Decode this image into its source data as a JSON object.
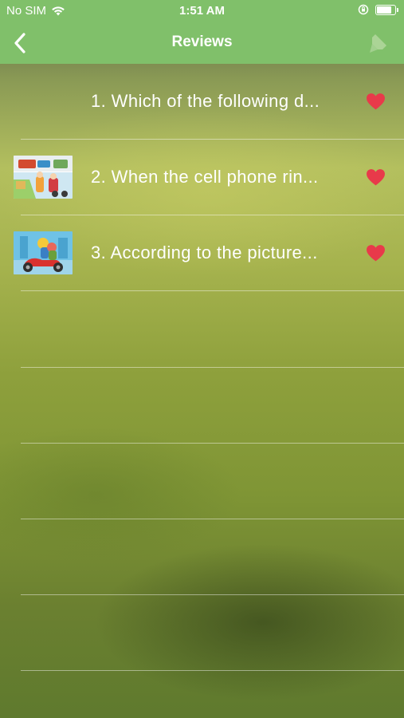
{
  "status_bar": {
    "carrier": "No SIM",
    "time": "1:51 AM",
    "battery_level": 0.9
  },
  "nav": {
    "title": "Reviews",
    "back_icon": "chevron-left-icon",
    "right_icon": "bookmark-icon"
  },
  "colors": {
    "bar": "#80c06a",
    "heart": "#e83a4a",
    "text": "#ffffff"
  },
  "reviews": [
    {
      "label": "1. Which of the following d...",
      "favorited": true,
      "has_image": false
    },
    {
      "label": "2. When the cell phone rin...",
      "favorited": true,
      "has_image": true,
      "image_icon": "traffic-scene-thumbnail"
    },
    {
      "label": "3. According to the picture...",
      "favorited": true,
      "has_image": true,
      "image_icon": "scooter-riders-thumbnail"
    }
  ]
}
